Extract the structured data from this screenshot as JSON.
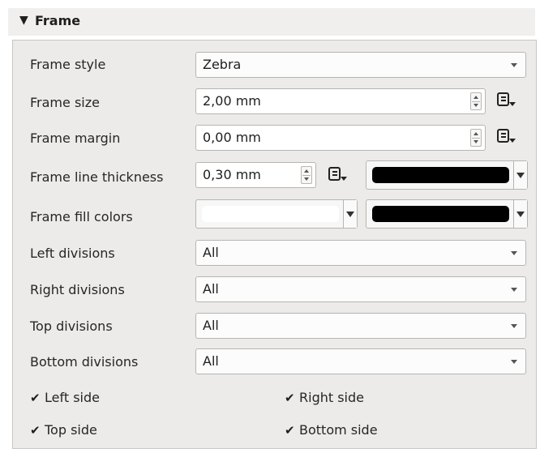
{
  "section": {
    "title": "Frame",
    "collapse_icon": "triangle-down-icon"
  },
  "rows": {
    "frame_style": {
      "label": "Frame style",
      "value": "Zebra"
    },
    "frame_size": {
      "label": "Frame size",
      "value": "2,00 mm"
    },
    "frame_margin": {
      "label": "Frame margin",
      "value": "0,00 mm"
    },
    "frame_line_thickness": {
      "label": "Frame line thickness",
      "value": "0,30 mm",
      "color": "#000000"
    },
    "frame_fill_colors": {
      "label": "Frame fill colors",
      "color1": "#ffffff",
      "color2": "#000000"
    },
    "left_divisions": {
      "label": "Left divisions",
      "value": "All"
    },
    "right_divisions": {
      "label": "Right divisions",
      "value": "All"
    },
    "top_divisions": {
      "label": "Top divisions",
      "value": "All"
    },
    "bottom_divisions": {
      "label": "Bottom divisions",
      "value": "All"
    }
  },
  "checkboxes": {
    "left_side": {
      "label": "Left side",
      "checked": true
    },
    "right_side": {
      "label": "Right side",
      "checked": true
    },
    "top_side": {
      "label": "Top side",
      "checked": true
    },
    "bottom_side": {
      "label": "Bottom side",
      "checked": true
    }
  },
  "icons": {
    "data_defined": "data-defined-override-icon"
  }
}
